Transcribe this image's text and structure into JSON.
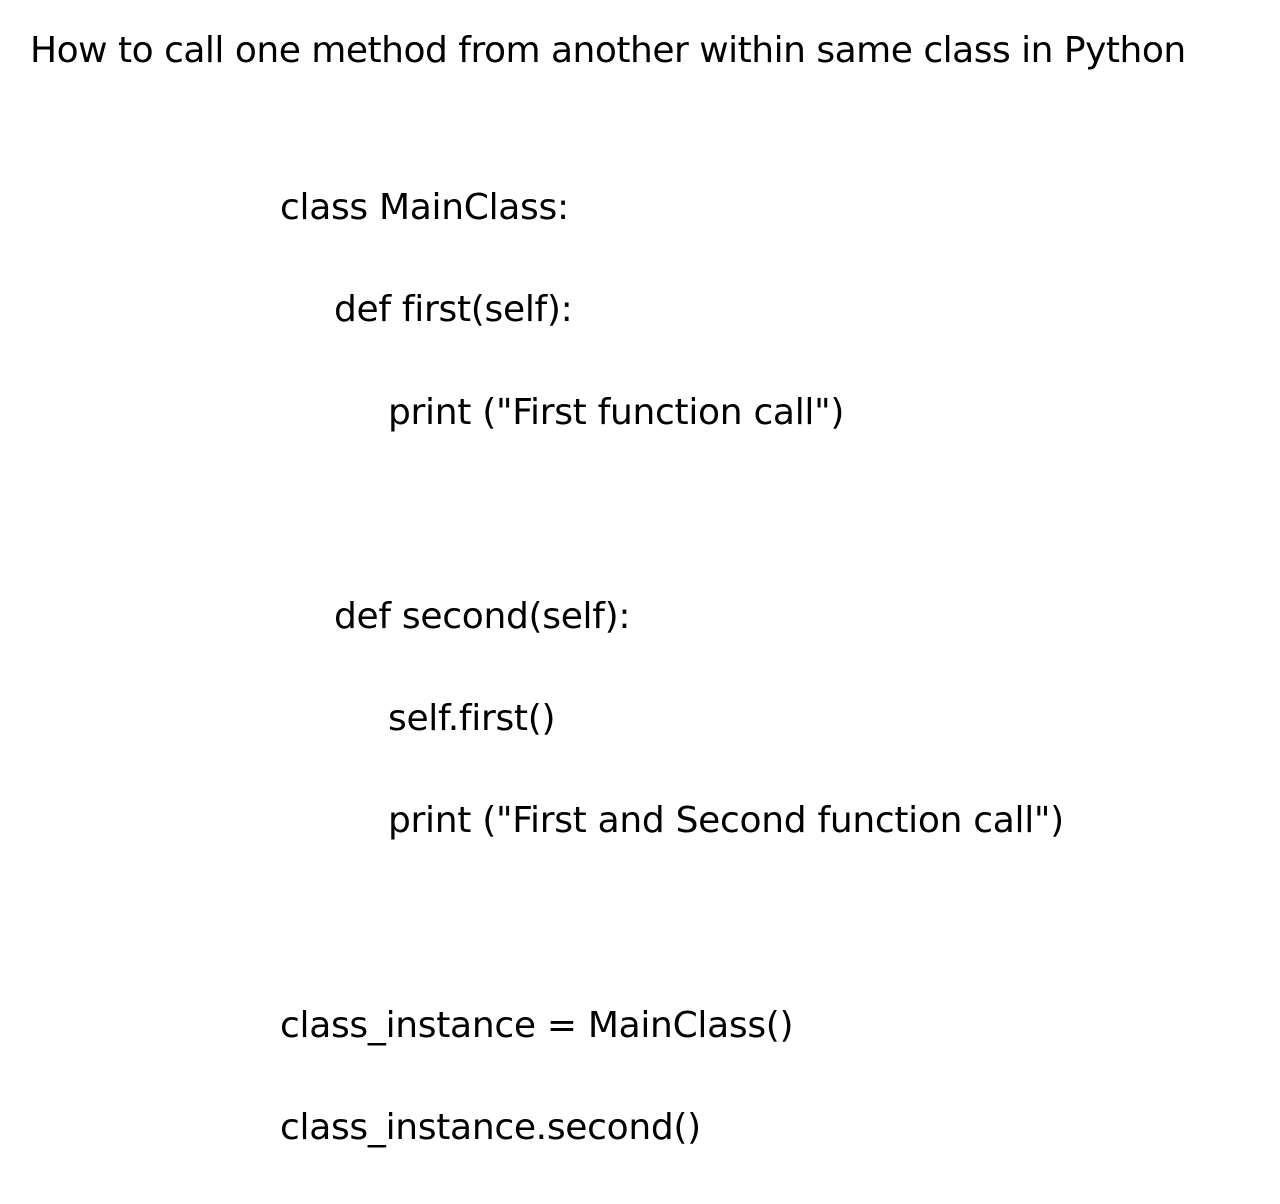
{
  "title": "How to call one method from another within same class in Python",
  "code": {
    "line1": "class MainClass:",
    "line2": "def first(self):",
    "line3": "print (\"First function call\")",
    "line4": "def second(self):",
    "line5": "self.first()",
    "line6": "print (\"First and Second function call\")",
    "line7": "class_instance = MainClass()",
    "line8": "class_instance.second()"
  }
}
